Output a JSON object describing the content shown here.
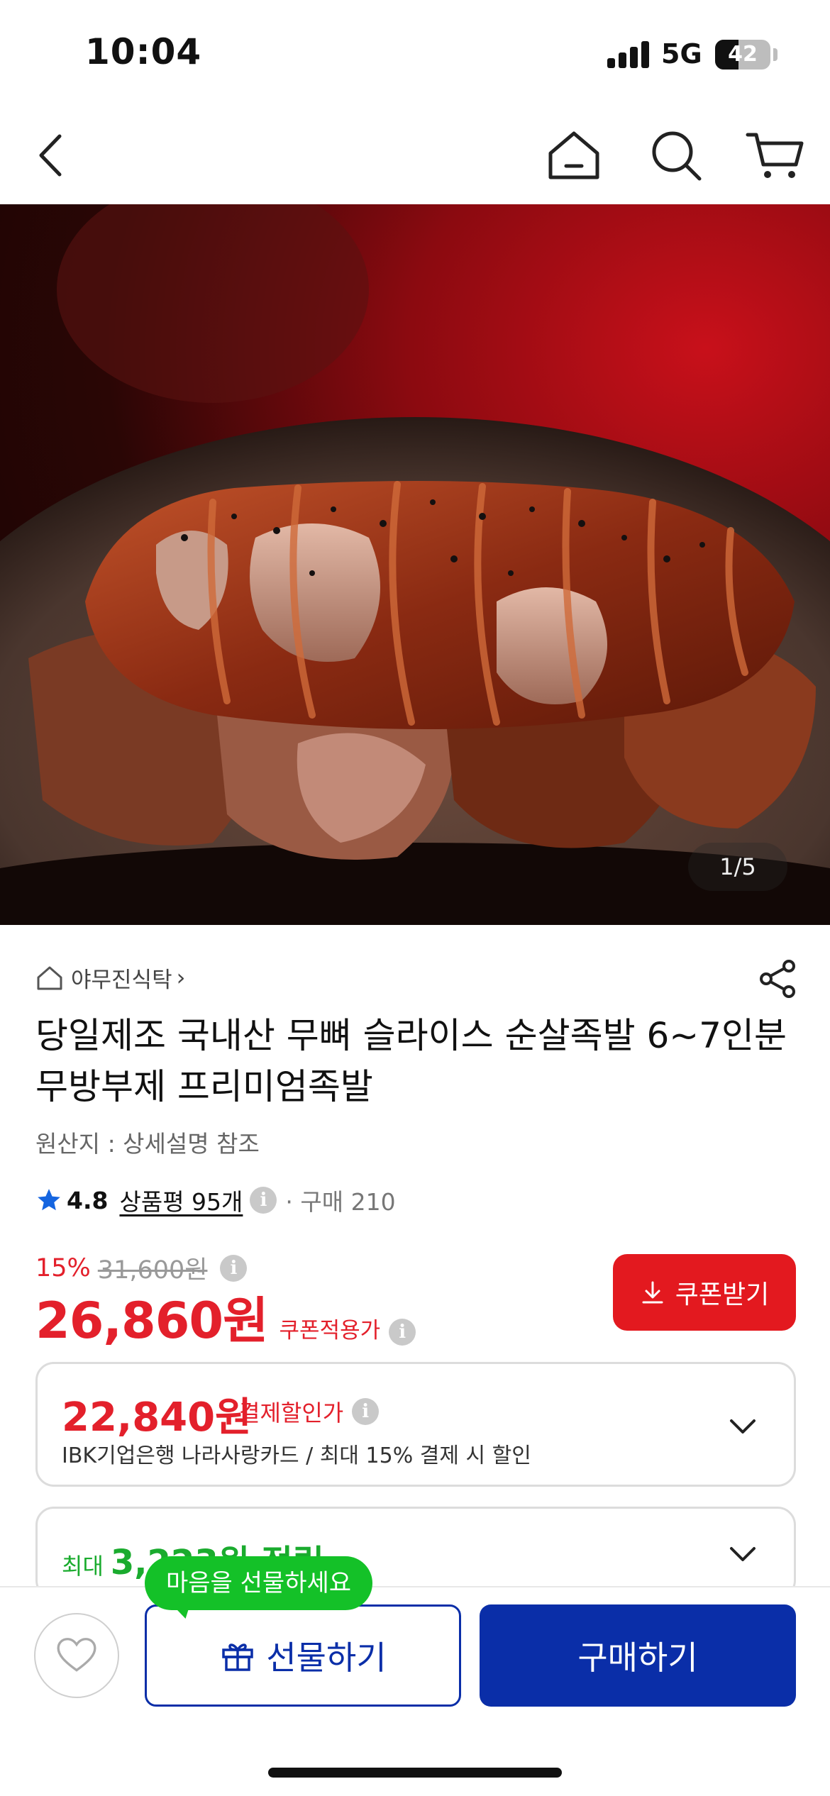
{
  "status_bar": {
    "time": "10:04",
    "network": "5G",
    "battery": "42",
    "battery_level": 0.42
  },
  "nav": {
    "icons": [
      "back-icon",
      "home-icon",
      "search-icon",
      "cart-icon"
    ]
  },
  "hero": {
    "page_indicator": "1/5"
  },
  "product": {
    "store_name": "야무진식탁",
    "store_chevron": "›",
    "title": "당일제조 국내산 무뼈 슬라이스 순살족발 6~7인분 무방부제 프리미엄족발",
    "origin": "원산지 : 상세설명 참조",
    "rating": "4.8",
    "reviews": "상품평 95개",
    "purchase_count": "· 구매 210",
    "discount_rate": "15%",
    "original_price": "31,600원",
    "price": "26,860원",
    "price_tag": "쿠폰적용가",
    "coupon_button": "쿠폰받기",
    "info_glyph": "i"
  },
  "payment_card": {
    "price": "22,840원",
    "tag": "결제할인가",
    "desc": "IBK기업은행 나라사랑카드 / 최대 15% 결제 시 할인"
  },
  "reward_card": {
    "prefix": "최대",
    "amount": "3,223원 적립"
  },
  "bottom": {
    "bubble": "마음을 선물하세요",
    "gift_button": "선물하기",
    "buy_button": "구매하기"
  },
  "colors": {
    "accent_red": "#e3202b",
    "accent_blue": "#0a2ea8",
    "accent_green": "#14c128",
    "reward_green": "#1aab2e"
  }
}
